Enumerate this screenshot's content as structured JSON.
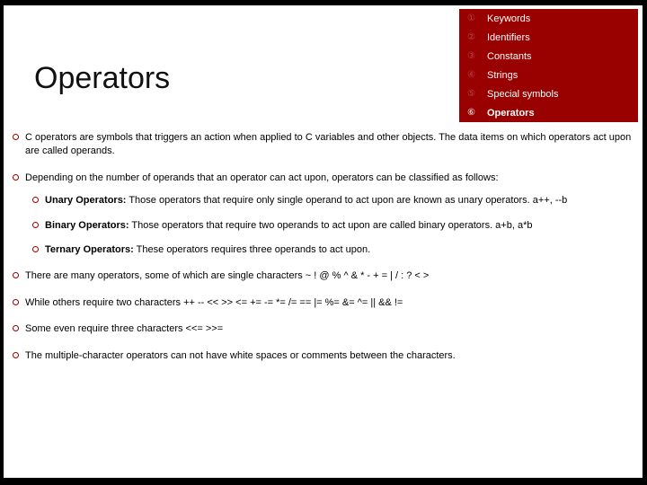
{
  "title": "Operators",
  "legend": {
    "items": [
      {
        "num": "①",
        "label": "Keywords"
      },
      {
        "num": "②",
        "label": "Identifiers"
      },
      {
        "num": "③",
        "label": "Constants"
      },
      {
        "num": "④",
        "label": "Strings"
      },
      {
        "num": "⑤",
        "label": "Special symbols"
      },
      {
        "num": "⑥",
        "label": "Operators"
      }
    ],
    "active_index": 5
  },
  "bullets": [
    {
      "text": "C operators are symbols that triggers an action when applied to C variables and other objects. The data items on which operators act upon are called operands."
    },
    {
      "text": "Depending on the number of operands that an operator can act upon, operators can be classified as follows:",
      "children": [
        {
          "bold": "Unary Operators:",
          "rest": " Those operators that require only single operand to act upon are known as unary operators. a++, --b"
        },
        {
          "bold": "Binary Operators:",
          "rest": " Those operators that require two operands to act upon are called binary operators. a+b, a*b"
        },
        {
          "bold": "Ternary Operators:",
          "rest": " These operators requires three operands to act upon."
        }
      ]
    },
    {
      "text": "There are many operators, some of which are single characters  ~   !  @   %   ^   &   *   -   +  =   |   /   :   ?   <   >"
    },
    {
      "text": "While others require two characters    ++  --  <<  >>  <=  +=  -=  *=  /=  ==  |=  %=  &=  ^=  ||  &&  !="
    },
    {
      "text": "Some even require three characters <<=  >>="
    },
    {
      "text": "The multiple-character operators can not have white spaces or comments between the characters."
    }
  ]
}
